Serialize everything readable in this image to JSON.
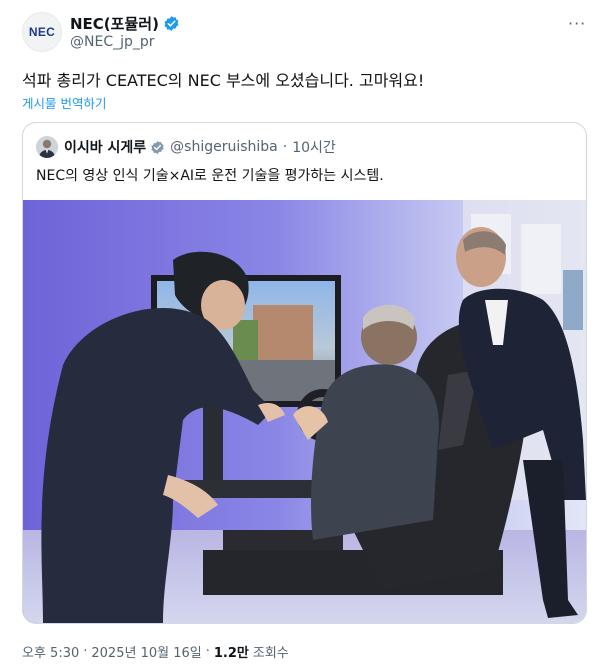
{
  "author": {
    "logo_text": "NEC",
    "display_name": "NEC(포뮬러)",
    "handle": "@NEC_jp_pr"
  },
  "more_menu": "···",
  "tweet": {
    "text": "석파 총리가 CEATEC의 NEC 부스에 오셨습니다. 고마워요!",
    "translate_label": "게시물 번역하기"
  },
  "quote": {
    "display_name": "이시바 시게루",
    "handle": "@shigeruishiba",
    "separator": "·",
    "time": "10시간",
    "text": "NEC의 영상 인식 기술×AI로 운전 기술을 평가하는 시스템."
  },
  "footer": {
    "time": "오후 5:30",
    "dot": "·",
    "date": "2025년 10월 16일",
    "views_count": "1.2만",
    "views_label": "조회수"
  },
  "colors": {
    "accent": "#1d9bf0",
    "secondary_text": "#536471",
    "border": "#cfd9de"
  },
  "icons": [
    "nec-logo",
    "verified-badge-icon",
    "more-options-icon",
    "profile-avatar"
  ]
}
